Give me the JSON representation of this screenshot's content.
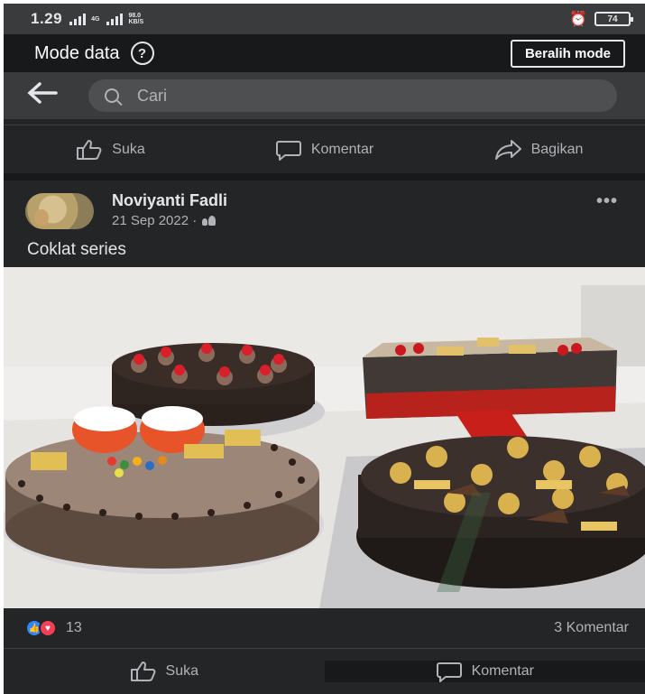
{
  "status_bar": {
    "time": "1.29",
    "network_speed_top": "98.0",
    "network_speed_unit": "KB/S",
    "network_type": "4G",
    "battery": "74"
  },
  "mode_bar": {
    "title": "Mode data",
    "help_icon": "question-circle-icon",
    "switch_button": "Beralih mode"
  },
  "search": {
    "placeholder": "Cari"
  },
  "top_actions": {
    "like": "Suka",
    "comment": "Komentar",
    "share": "Bagikan"
  },
  "post": {
    "author": "Noviyanti Fadli",
    "date": "21 Sep 2022 ·",
    "audience_icon": "friends-icon",
    "caption": "Coklat series",
    "reaction_count": "13",
    "comment_count": "3 Komentar"
  },
  "bottom_actions": {
    "like": "Suka",
    "comment": "Komentar"
  },
  "colors": {
    "background": "#242526",
    "header_dark": "#18191a",
    "bar": "#3a3b3c",
    "text": "#e4e6eb",
    "secondary_text": "#b0b3b8",
    "like_blue": "#2d88ff",
    "love_red": "#f33e58"
  }
}
